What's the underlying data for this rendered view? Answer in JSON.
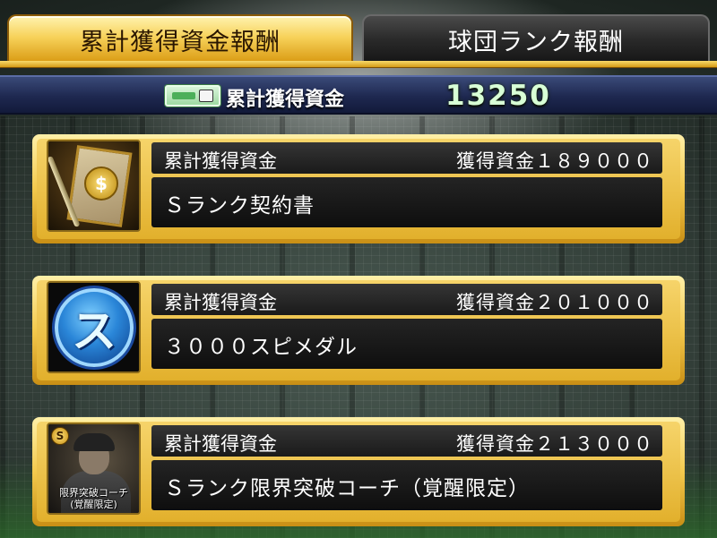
{
  "tabs": [
    {
      "label": "累計獲得資金報酬",
      "active": true
    },
    {
      "label": "球団ランク報酬",
      "active": false
    }
  ],
  "summary": {
    "icon": "money-icon",
    "label": "累計獲得資金",
    "value": "13250"
  },
  "rewards": [
    {
      "condition_label": "累計獲得資金",
      "amount_text": "獲得資金１８９０００",
      "reward_name": "Ｓランク契約書",
      "icon": "contract-icon"
    },
    {
      "condition_label": "累計獲得資金",
      "amount_text": "獲得資金２０１０００",
      "reward_name": "３０００スピメダル",
      "icon": "medal-icon",
      "icon_letter": "ス"
    },
    {
      "condition_label": "累計獲得資金",
      "amount_text": "獲得資金２１３０００",
      "reward_name": "Ｓランク限界突破コーチ（覚醒限定）",
      "icon": "coach-icon",
      "icon_badge": "S",
      "icon_caption_line1": "限界突破コーチ",
      "icon_caption_line2": "(覚醒限定)"
    }
  ],
  "colors": {
    "gold": "#f3c94d",
    "navy_bar": "#1e2850",
    "value_text": "#d8ffd6"
  }
}
